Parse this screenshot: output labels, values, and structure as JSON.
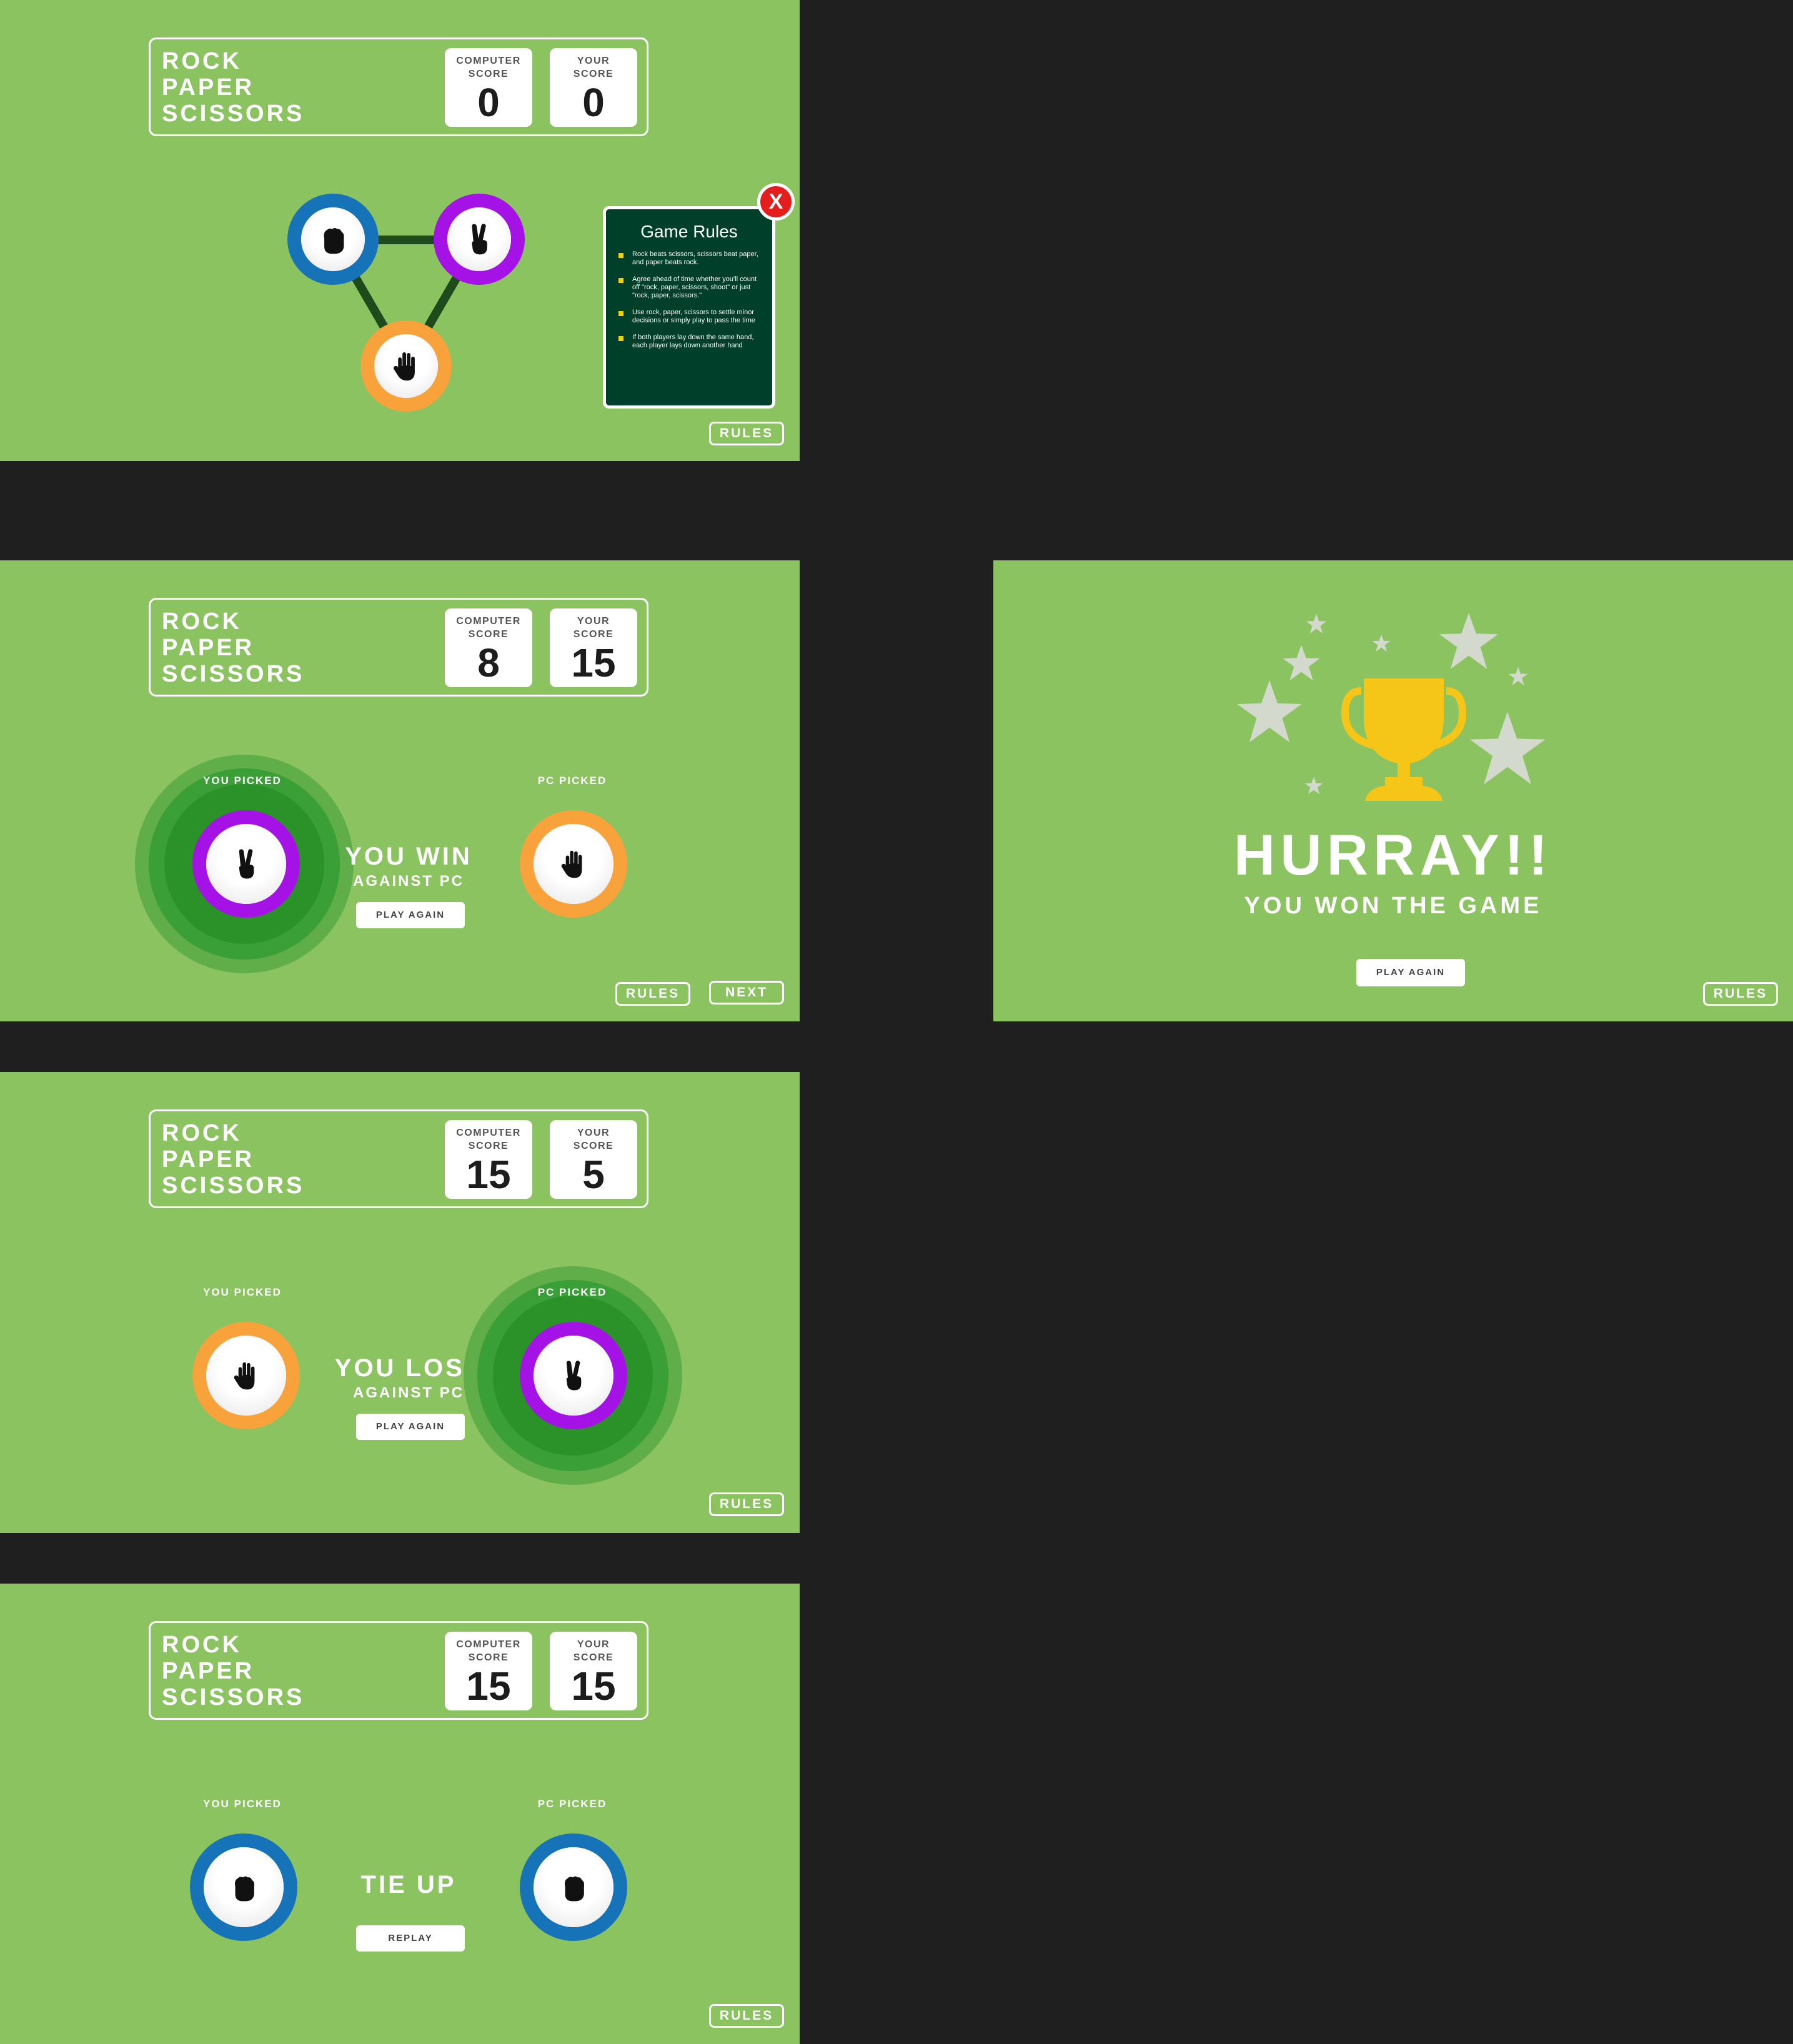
{
  "game_title": [
    "ROCK",
    "PAPER",
    "SCISSORS"
  ],
  "score_labels": {
    "computer": [
      "COMPUTER",
      "SCORE"
    ],
    "you": [
      "YOUR",
      "SCORE"
    ]
  },
  "buttons": {
    "rules": "RULES",
    "next": "NEXT",
    "play_again": "PLAY AGAIN",
    "replay": "REPLAY"
  },
  "pick_labels": {
    "you": "YOU PICKED",
    "pc": "PC PICKED"
  },
  "rules_popup": {
    "title": "Game Rules",
    "close": "X",
    "items": [
      "Rock beats scissors, scissors beat paper, and paper beats rock.",
      "Agree ahead of time whether you'll count off \"rock, paper, scissors, shoot\" or just \"rock, paper, scissors.\"",
      "Use rock, paper, scissors to settle minor decisions or simply play to pass the time",
      "If both players lay down the same hand, each player lays down another hand"
    ]
  },
  "screens": {
    "start": {
      "computer_score": "0",
      "your_score": "0"
    },
    "win": {
      "computer_score": "8",
      "your_score": "15",
      "you_picked": "scissors",
      "pc_picked": "paper",
      "result_line1": "YOU WIN",
      "result_line2": "AGAINST PC"
    },
    "lost": {
      "computer_score": "15",
      "your_score": "5",
      "you_picked": "paper",
      "pc_picked": "scissors",
      "result_line1": "YOU LOST",
      "result_line2": "AGAINST PC"
    },
    "tie": {
      "computer_score": "15",
      "your_score": "15",
      "you_picked": "rock",
      "pc_picked": "rock",
      "result_line1": "TIE UP"
    },
    "victory": {
      "headline": "HURRAY!!",
      "subline": "YOU WON THE GAME"
    }
  },
  "colors": {
    "background": "#8bc360",
    "rock": "#1673b7",
    "scissors": "#a512e6",
    "paper": "#f7a23b",
    "halo": "#2e9f2e",
    "trophy": "#f5c518",
    "rules_card": "#00402a",
    "close": "#e41d1d"
  },
  "icons": {
    "rock": "fist-icon",
    "paper": "open-hand-icon",
    "scissors": "victory-hand-icon",
    "trophy": "trophy-icon",
    "star": "star-icon"
  }
}
